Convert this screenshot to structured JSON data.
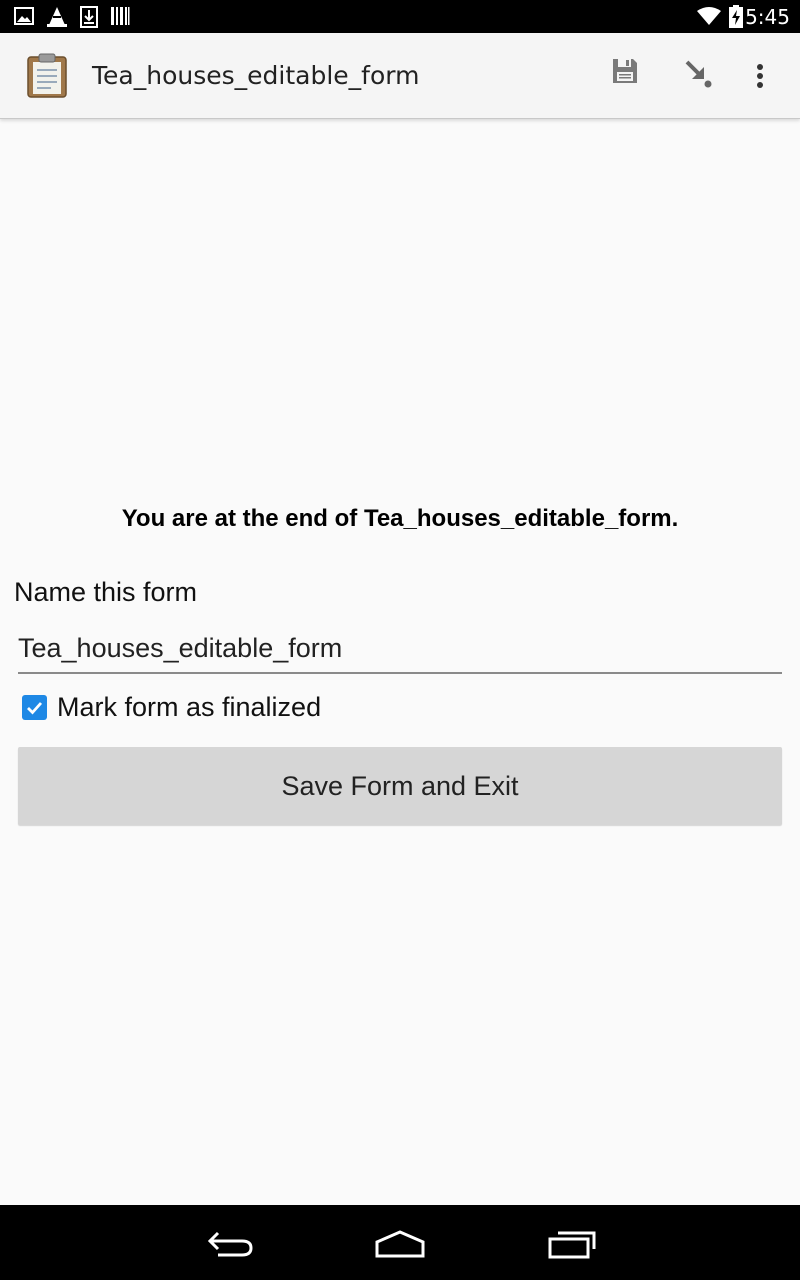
{
  "status_bar": {
    "time": "5:45",
    "icons": [
      "gallery-icon",
      "vlc-cone-icon",
      "download-icon",
      "barcode-icon",
      "wifi-icon",
      "battery-charging-icon"
    ]
  },
  "action_bar": {
    "title": "Tea_houses_editable_form",
    "icons": [
      "clipboard-icon",
      "save-icon",
      "goto-icon",
      "overflow-menu-icon"
    ]
  },
  "main": {
    "end_message": "You are at the end of Tea_houses_editable_form.",
    "name_label": "Name this form",
    "name_value": "Tea_houses_editable_form",
    "finalize_label": "Mark form as finalized",
    "finalize_checked": true,
    "save_button_label": "Save Form and Exit"
  },
  "nav_bar": {
    "icons": [
      "back-icon",
      "home-icon",
      "recents-icon"
    ]
  },
  "colors": {
    "checkbox_accent": "#1e88e5",
    "button_bg": "#d6d6d6",
    "background": "#fafafa"
  }
}
